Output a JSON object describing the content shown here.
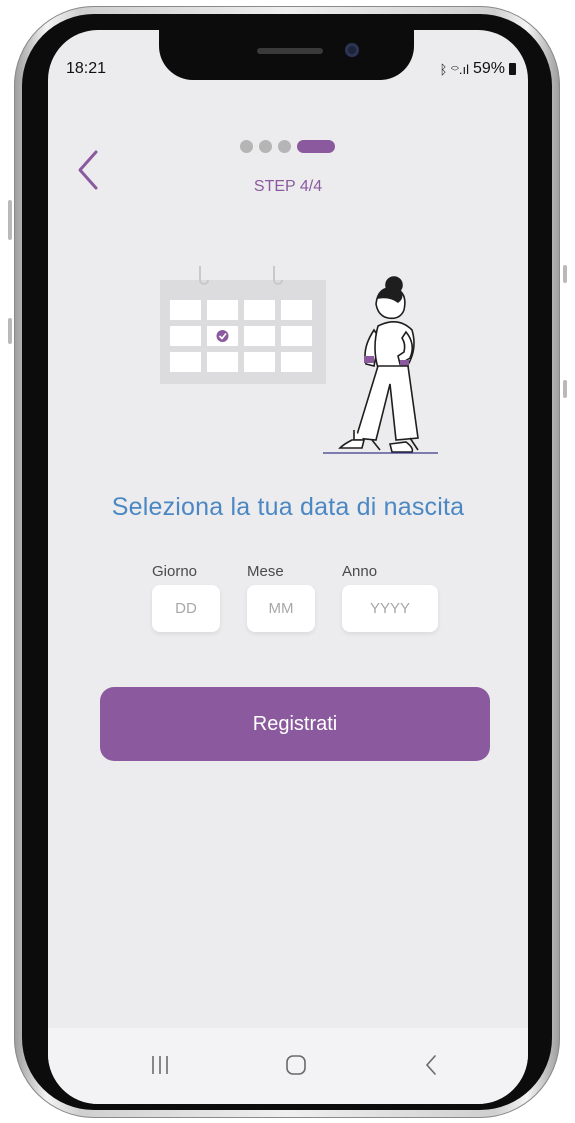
{
  "status_bar": {
    "time": "18:21",
    "signal_text": "ᛒ ⌔.ıl",
    "battery_percent": "59%"
  },
  "progress": {
    "total_steps": 4,
    "current_step": 4,
    "label": "STEP 4/4"
  },
  "page": {
    "title": "Seleziona la tua data di nascita"
  },
  "birth_date": {
    "day": {
      "label": "Giorno",
      "placeholder": "DD",
      "value": ""
    },
    "month": {
      "label": "Mese",
      "placeholder": "MM",
      "value": ""
    },
    "year": {
      "label": "Anno",
      "placeholder": "YYYY",
      "value": ""
    }
  },
  "actions": {
    "register_label": "Registrati"
  },
  "icons": {
    "back": "chevron-left-icon",
    "calendar_check": "check-circle-icon",
    "nav_recents": "recents-icon",
    "nav_home": "home-icon",
    "nav_back": "nav-back-icon"
  },
  "colors": {
    "accent": "#8b5a9e",
    "title": "#4b88c3",
    "background": "#ececee"
  }
}
